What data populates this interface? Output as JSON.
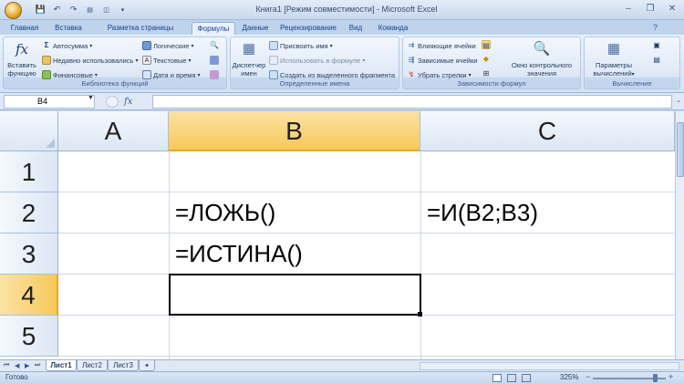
{
  "window": {
    "title": "Книга1  [Режим совместимости] - Microsoft Excel",
    "minimize": "–",
    "restore": "❐",
    "close": "✕"
  },
  "qat": {
    "save": "💾",
    "undo": "↶",
    "redo": "↷"
  },
  "tabs": [
    "Главная",
    "Вставка",
    "Разметка страницы",
    "Формулы",
    "Данные",
    "Рецензирование",
    "Вид",
    "Команда"
  ],
  "active_tab": "Формулы",
  "ribbon": {
    "insert_function": {
      "line1": "Вставить",
      "line2": "функцию",
      "icon": "fx"
    },
    "library": {
      "label": "Библиотека функций",
      "autosum": "Автосумма",
      "recent": "Недавно использовались",
      "financial": "Финансовые",
      "logical": "Логические",
      "text": "Текстовые",
      "datetime": "Дата и время"
    },
    "names": {
      "label": "Определенные имена",
      "manager_line1": "Диспетчер",
      "manager_line2": "имен",
      "assign": "Присвоить имя",
      "use_in_formula": "Использовать в формуле",
      "create_from_selection": "Создать из выделенного фрагмента"
    },
    "audit": {
      "label": "Зависимости формул",
      "precedents": "Влияющие ячейки",
      "dependents": "Зависимые ячейки",
      "remove_arrows": "Убрать стрелки",
      "watch_line1": "Окно контрольного",
      "watch_line2": "значения"
    },
    "calc": {
      "label": "Вычисление",
      "options_line1": "Параметры",
      "options_line2": "вычислений"
    }
  },
  "formula_bar": {
    "name_box": "B4",
    "fx": "fx",
    "formula": ""
  },
  "columns": [
    "A",
    "B",
    "C"
  ],
  "selected_column": "B",
  "rows": [
    "1",
    "2",
    "3",
    "4",
    "5"
  ],
  "selected_row": "4",
  "cells": {
    "B2": "=ЛОЖЬ()",
    "C2": "=И(B2;B3)",
    "B3": "=ИСТИНА()"
  },
  "sheets": [
    "Лист1",
    "Лист2",
    "Лист3"
  ],
  "active_sheet": "Лист1",
  "status": {
    "text": "Готово",
    "zoom": "325%"
  }
}
